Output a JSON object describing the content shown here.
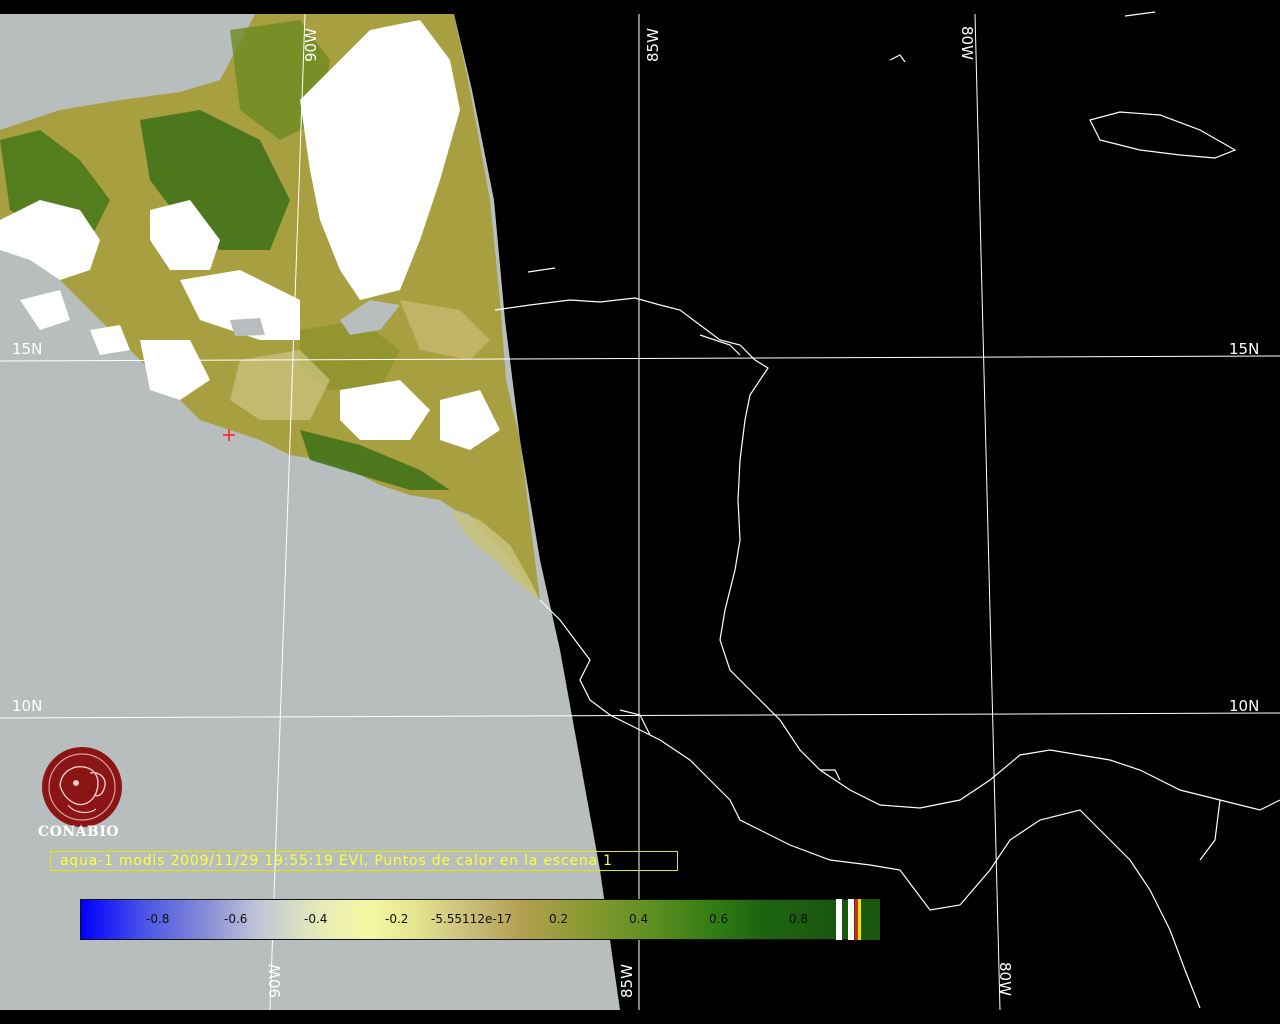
{
  "map": {
    "graticule_labels": {
      "lon_top": [
        "90W",
        "85W",
        "80W"
      ],
      "lon_bottom": [
        "90W",
        "85W",
        "80W"
      ],
      "lat_left": [
        "15N",
        "10N"
      ],
      "lat_right": [
        "15N",
        "10N"
      ]
    },
    "colors": {
      "ocean_covered": "#b8bebd",
      "ocean_uncovered": "#000000",
      "coastline": "#ffffff",
      "cloud": "#ffffff",
      "fire_marker": "#ff2020"
    }
  },
  "logo": {
    "text": "CONABIO",
    "color": "#8b1414"
  },
  "caption": {
    "text": "aqua-1 modis 2009/11/29 19:55:19 EVI, Puntos de calor en la escena 1",
    "color": "#ffff33"
  },
  "colorbar": {
    "ticks": [
      "-0.8",
      "-0.6",
      "-0.4",
      "-0.2",
      "-5.55112e-17",
      "0.2",
      "0.4",
      "0.6",
      "0.8"
    ]
  }
}
